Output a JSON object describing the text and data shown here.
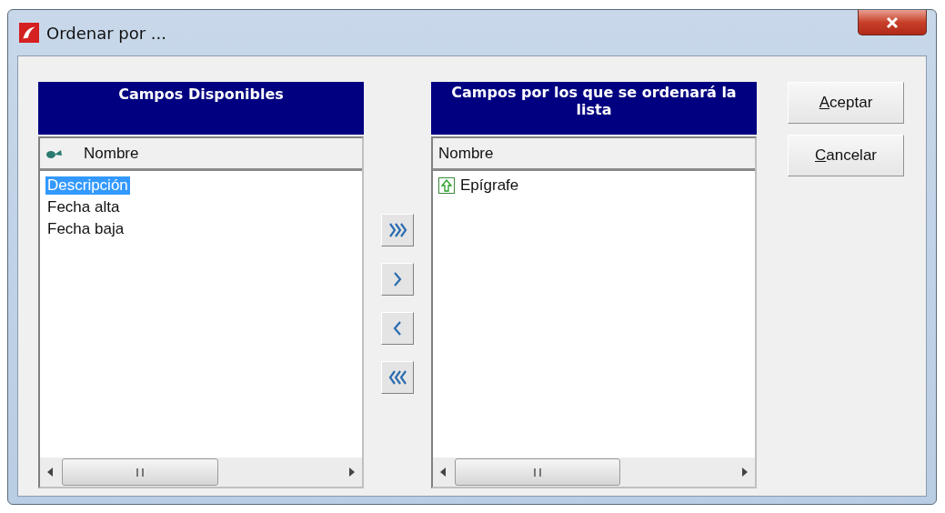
{
  "window": {
    "title": "Ordenar por ..."
  },
  "available": {
    "title": "Campos Disponibles",
    "column": "Nombre",
    "items": [
      {
        "label": "Descripción",
        "selected": true
      },
      {
        "label": "Fecha alta",
        "selected": false
      },
      {
        "label": "Fecha baja",
        "selected": false
      }
    ]
  },
  "move_buttons": [
    {
      "kind": "all-right"
    },
    {
      "kind": "right"
    },
    {
      "kind": "left"
    },
    {
      "kind": "all-left"
    }
  ],
  "sort": {
    "title": "Campos por los que se ordenará la lista",
    "column": "Nombre",
    "items": [
      {
        "label": "Epígrafe",
        "kind": "ascending"
      }
    ]
  },
  "buttons": [
    {
      "label": "Aceptar"
    },
    {
      "label": "Cancelar"
    }
  ]
}
